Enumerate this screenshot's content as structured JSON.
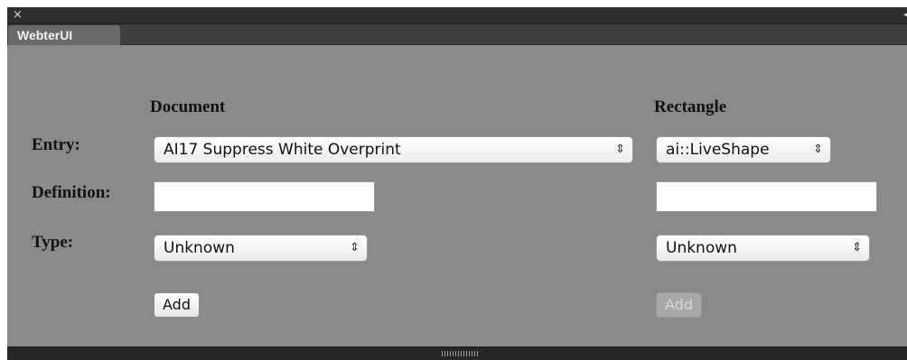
{
  "window": {
    "close_icon": "×",
    "collapse_icon": "◂◂",
    "tab_label": "WebterUI"
  },
  "columns": {
    "document_header": "Document",
    "rectangle_header": "Rectangle"
  },
  "labels": {
    "entry": "Entry:",
    "definition": "Definition:",
    "type": "Type:"
  },
  "document": {
    "entry_value": "AI17 Suppress White Overprint",
    "definition_value": "",
    "type_value": "Unknown",
    "add_label": "Add"
  },
  "rectangle": {
    "entry_value": "ai::LiveShape",
    "definition_value": "",
    "type_value": "Unknown",
    "add_label": "Add",
    "add_disabled": true
  },
  "select_arrow": "⇕"
}
